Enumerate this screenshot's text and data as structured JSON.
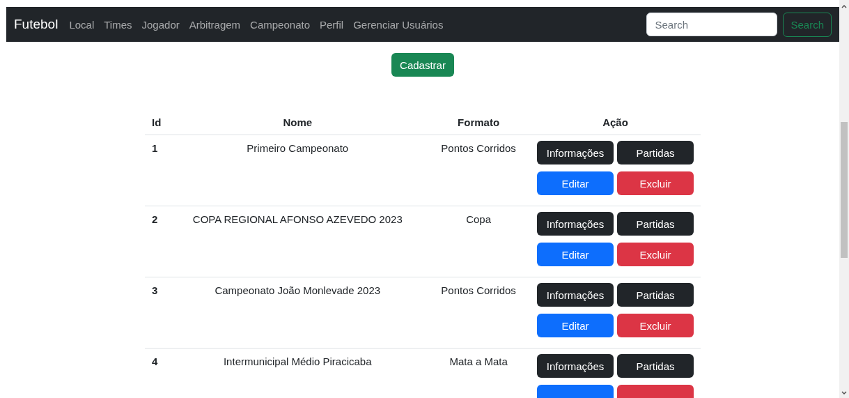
{
  "navbar": {
    "brand": "Futebol",
    "links": [
      "Local",
      "Times",
      "Jogador",
      "Arbitragem",
      "Campeonato",
      "Perfil",
      "Gerenciar Usuários"
    ],
    "search": {
      "placeholder": "Search"
    },
    "search_button": "Search"
  },
  "register_button": "Cadastrar",
  "table": {
    "columns": [
      "Id",
      "Nome",
      "Formato",
      "Ação"
    ],
    "rows": [
      {
        "id": "1",
        "nome": "Primeiro Campeonato",
        "formato": "Pontos Corridos",
        "actions": [
          {
            "label": "Informações",
            "kind": "dark"
          },
          {
            "label": "Partidas",
            "kind": "dark"
          },
          {
            "label": "Editar",
            "kind": "primary"
          },
          {
            "label": "Excluir",
            "kind": "danger"
          }
        ]
      },
      {
        "id": "2",
        "nome": "COPA REGIONAL AFONSO AZEVEDO 2023",
        "formato": "Copa",
        "actions": [
          {
            "label": "Informações",
            "kind": "dark"
          },
          {
            "label": "Partidas",
            "kind": "dark"
          },
          {
            "label": "Editar",
            "kind": "primary"
          },
          {
            "label": "Excluir",
            "kind": "danger"
          }
        ]
      },
      {
        "id": "3",
        "nome": "Campeonato João Monlevade 2023",
        "formato": "Pontos Corridos",
        "actions": [
          {
            "label": "Informações",
            "kind": "dark"
          },
          {
            "label": "Partidas",
            "kind": "dark"
          },
          {
            "label": "Editar",
            "kind": "primary"
          },
          {
            "label": "Excluir",
            "kind": "danger"
          }
        ]
      },
      {
        "id": "4",
        "nome": "Intermunicipal Médio Piracicaba",
        "formato": "Mata a Mata",
        "actions": [
          {
            "label": "Informações",
            "kind": "dark"
          },
          {
            "label": "Partidas",
            "kind": "dark"
          },
          {
            "kind": "primary"
          },
          {
            "kind": "danger"
          }
        ]
      }
    ]
  }
}
